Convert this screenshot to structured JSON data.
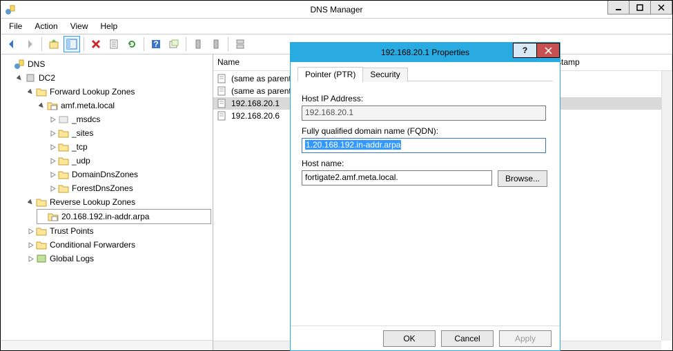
{
  "window": {
    "title": "DNS Manager"
  },
  "menu": {
    "file": "File",
    "action": "Action",
    "view": "View",
    "help": "Help"
  },
  "tree": {
    "root": "DNS",
    "server": "DC2",
    "flz": "Forward Lookup Zones",
    "zone": "amf.meta.local",
    "sub": {
      "msdcs": "_msdcs",
      "sites": "_sites",
      "tcp": "_tcp",
      "udp": "_udp",
      "ddz": "DomainDnsZones",
      "fdz": "ForestDnsZones"
    },
    "rlz": "Reverse Lookup Zones",
    "rzone": "20.168.192.in-addr.arpa",
    "tp": "Trust Points",
    "cf": "Conditional Forwarders",
    "gl": "Global Logs"
  },
  "list": {
    "col_name": "Name",
    "col_stamp": "stamp",
    "rows": {
      "r0": "(same as parent f",
      "r1": "(same as parent f",
      "r2": "192.168.20.1",
      "r3": "192.168.20.6"
    }
  },
  "dialog": {
    "title": "192.168.20.1 Properties",
    "tab_ptr": "Pointer (PTR)",
    "tab_sec": "Security",
    "lbl_ip": "Host IP Address:",
    "val_ip": "192.168.20.1",
    "lbl_fqdn": "Fully qualified domain name (FQDN):",
    "val_fqdn": "1.20.168.192.in-addr.arpa",
    "lbl_host": "Host name:",
    "val_host": "fortigate2.amf.meta.local.",
    "browse": "Browse...",
    "ok": "OK",
    "cancel": "Cancel",
    "apply": "Apply",
    "help": "?"
  }
}
